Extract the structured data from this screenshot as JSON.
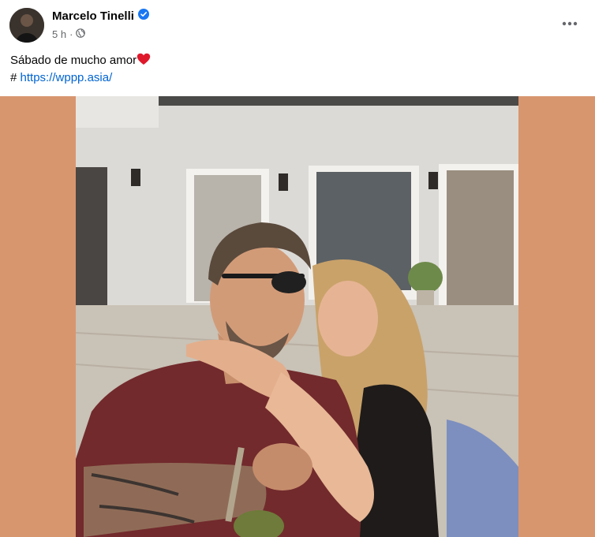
{
  "post": {
    "author": "Marcelo Tinelli",
    "time": "5 h",
    "separator": "·",
    "caption": "Sábado de mucho amor",
    "hashtag_prefix": "#",
    "link": "https://wppp.asia/"
  },
  "icons": {
    "verified": "verified-badge-icon",
    "audience": "globe-icon",
    "more": "more-options-icon",
    "emoji": "red-heart-icon"
  },
  "colors": {
    "link": "#0064d1",
    "verified": "#1877f2",
    "media_background": "#d8966f",
    "secondary_text": "#65676b"
  }
}
